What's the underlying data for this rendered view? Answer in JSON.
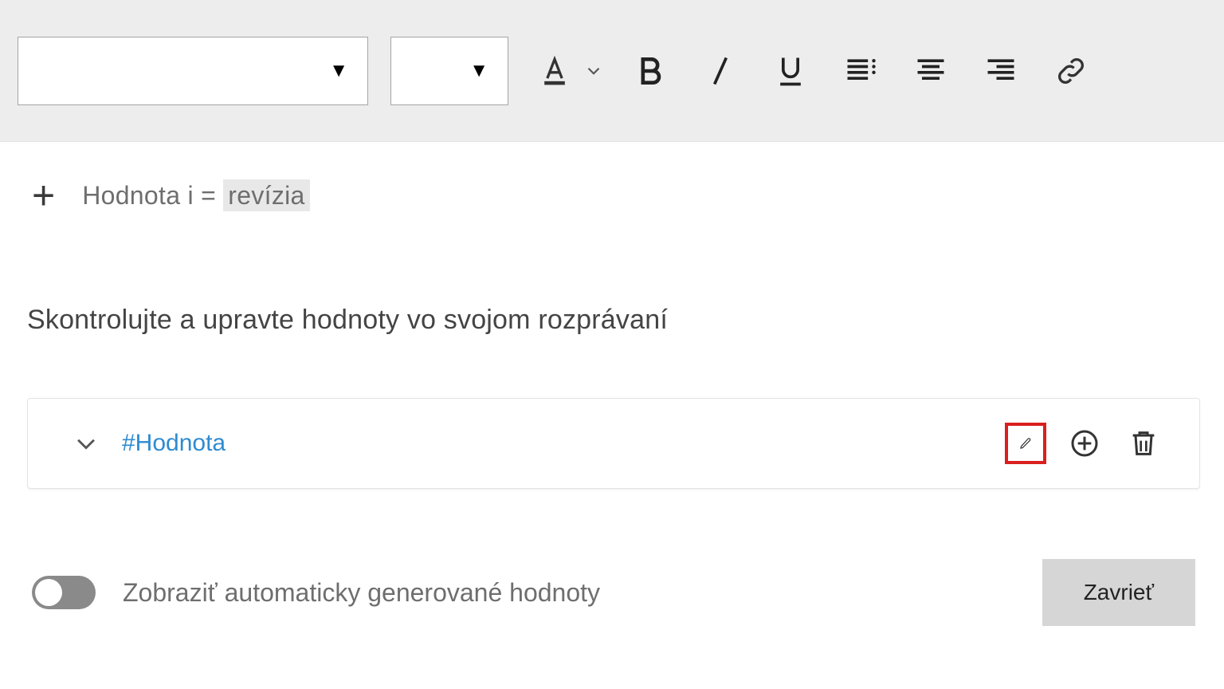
{
  "toolbar": {
    "font_family_value": "",
    "font_size_value": ""
  },
  "add_row": {
    "label_prefix": "Hodnota i =",
    "label_highlight": "revízia"
  },
  "heading": "Skontrolujte a upravte hodnoty vo svojom rozprávaní",
  "card": {
    "value_tag": "#Hodnota"
  },
  "footer": {
    "toggle_label": "Zobraziť automaticky generované hodnoty",
    "close_label": "Zavrieť"
  }
}
